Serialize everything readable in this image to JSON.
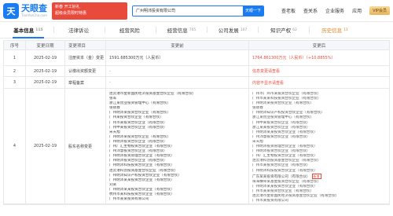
{
  "header": {
    "logo_mark": "天",
    "logo_name": "天眼查",
    "logo_sub": "TianYanCha.com",
    "promo_lines": [
      "新春 开工好礼",
      "超级会员限时特惠",
      "查询更多企业信息"
    ],
    "search_value": "广州明沛投资有限公司",
    "search_button": "天眼一下",
    "nav": [
      "查老板",
      "查关系",
      "企业服务",
      "应用"
    ],
    "vip_label": "VIP会员"
  },
  "tabs": [
    {
      "label": "基本信息",
      "count": "115"
    },
    {
      "label": "法律诉讼",
      "count": ""
    },
    {
      "label": "经营风险",
      "count": ""
    },
    {
      "label": "经营信息",
      "count": "765"
    },
    {
      "label": "公司发展",
      "count": "107"
    },
    {
      "label": "知识产权",
      "count": "62"
    },
    {
      "label": "历史信息",
      "count": "11"
    }
  ],
  "table": {
    "headers": {
      "idx": "序号",
      "date": "变更日期",
      "item": "变更项目",
      "before": "变更前",
      "after": "变更后"
    },
    "rows": [
      {
        "idx": "1",
        "date": "2025-02-19",
        "item": "注册资本（金）变更",
        "before": "1591.685300万元（人民币）",
        "after": "1764.861300万元（人民币）（+10.8855%）"
      },
      {
        "idx": "2",
        "date": "2025-02-19",
        "item": "认缴出资额变更",
        "before": "-",
        "after": "-"
      },
      {
        "idx": "3",
        "date": "2025-02-19",
        "item": "章程备案",
        "before": "-",
        "after": "-"
      }
    ],
    "after_row2_red": "信息变更请查看",
    "after_row3_red": "内容不显示请查看",
    "big_row": {
      "idx": "4",
      "date": "2025-02-19",
      "item": "股东名称变更",
      "before_lines": [
        "连云港市金新国民经济投资基金合伙企业（有限合伙）",
        "张军",
        "浙江某创业投资管理中心（有限合伙）",
        "张晓春",
        "广州明沛某投资合伙企业（有限合伙）",
        "广州某投资合伙企业（有限合伙）",
        "广州市某投资合伙企业（有限合伙）",
        "广州中某投资合伙企业（有限合伙）",
        "宋天旭",
        "广州明沛某投资合伙企业（有限合伙）",
        "广州明沛投资合伙企业（有限合伙）",
        "广州广汇生物投资合伙企业（有限合伙）",
        "广州沛慧投资合伙企业（有限合伙）",
        "广州明沛投资管理合伙企业（有限合伙）",
        "广州明沛投资合伙企业（有限合伙）",
        "广州明沛科技投资合伙企业（有限合伙）",
        "连云港科创投资基金合伙企业（有限合伙）",
        "广州明沛知识产权投资合伙企业（有限合伙）",
        "广州明沛某某投资合伙企业（有限合伙）",
        "刘某",
        "广州明沛某某投资合伙企业（有限合伙）",
        "杭州市某科技投资合伙企业（有限合伙）",
        "广州市某某投资有限公司"
      ],
      "after_lines": [
        "广州市广州市某投资合伙企业（有限合伙）",
        "广州市某某科技投资合伙企业（有限合伙）",
        "广州明沛某投资合伙企业（有限合伙）",
        "张晓春",
        "广州明沛知识产权投资合伙企业（有限合伙）",
        "浙江某创业投资管理中心（有限合伙）",
        "广州中某投资合伙企业（有限合伙）",
        "浙江某某投资合伙企业（有限合伙）",
        "广州明沛某某投资合伙企业（有限合伙）",
        "广州沛慧投资合伙企业（有限合伙）",
        "宋天旭",
        "广州明沛投资管理合伙企业（有限合伙）",
        "广州明沛投资合伙企业（有限合伙）",
        "广州广汇生物投资合伙企业（有限合伙）",
        "连云港科创投资基金合伙企业（有限合伙）",
        "广州市某投资合伙企业（有限合伙）",
        "广州明沛科技投资合伙企业（有限合伙）",
        "广东某某投资有限公司（有限合伙）",
        "珠海横琴某基金投资合伙企业（有限合伙）",
        "广州明沛某某投资合伙企业（有限合伙）",
        "广州市某某投资合伙企业（有限合伙）",
        "连云港市金新国民经济投资基金合伙企业（有限合伙）",
        "广州市某投资有限公司",
        "连云港某科技投资合伙企业（有限合伙）"
      ],
      "after_tag": "新增"
    }
  }
}
